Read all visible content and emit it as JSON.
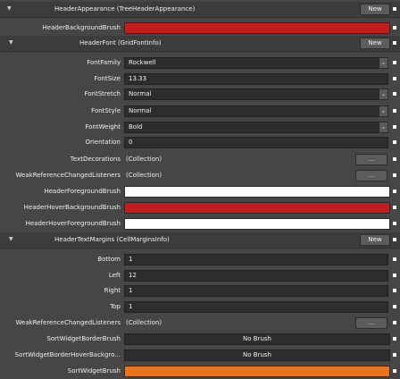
{
  "colors": {
    "red_brush": "#c41c1c",
    "white_brush": "#ffffff",
    "orange_brush": "#e8741e"
  },
  "icons": {
    "expand": "▼",
    "dropdown": "⌄",
    "ellipsis": "..."
  },
  "header_appearance": {
    "label": "HeaderAppearance (TreeHeaderAppearance)",
    "new_label": "New"
  },
  "header_background_brush": {
    "label": "HeaderBackgroundBrush"
  },
  "header_font": {
    "label": "HeaderFont (GridFontInfo)",
    "new_label": "New",
    "font_family": {
      "label": "FontFamily",
      "value": "Rockwell"
    },
    "font_size": {
      "label": "FontSize",
      "value": "13.33"
    },
    "font_stretch": {
      "label": "FontStretch",
      "value": "Normal"
    },
    "font_style": {
      "label": "FontStyle",
      "value": "Normal"
    },
    "font_weight": {
      "label": "FontWeight",
      "value": "Bold"
    },
    "orientation": {
      "label": "Orientation",
      "value": "0"
    },
    "text_decorations": {
      "label": "TextDecorations",
      "value": "(Collection)",
      "button": "..."
    },
    "weak_ref": {
      "label": "WeakReferenceChangedListeners",
      "value": "(Collection)",
      "button": "..."
    }
  },
  "header_foreground_brush": {
    "label": "HeaderForegroundBrush"
  },
  "header_hover_background_brush": {
    "label": "HeaderHoverBackgroundBrush"
  },
  "header_hover_foreground_brush": {
    "label": "HeaderHoverForegroundBrush"
  },
  "header_text_margins": {
    "label": "HeaderTextMargins (CellMarginsInfo)",
    "new_label": "New",
    "bottom": {
      "label": "Bottom",
      "value": "1"
    },
    "left": {
      "label": "Left",
      "value": "12"
    },
    "right": {
      "label": "Right",
      "value": "1"
    },
    "top": {
      "label": "Top",
      "value": "1"
    },
    "weak_ref": {
      "label": "WeakReferenceChangedListeners",
      "value": "(Collection)",
      "button": "..."
    }
  },
  "sort_widget_border_brush": {
    "label": "SortWidgetBorderBrush",
    "value": "No Brush"
  },
  "sort_widget_border_hover": {
    "label": "SortWidgetBorderHoverBackgro...",
    "value": "No Brush"
  },
  "sort_widget_brush": {
    "label": "SortWidgetBrush"
  }
}
